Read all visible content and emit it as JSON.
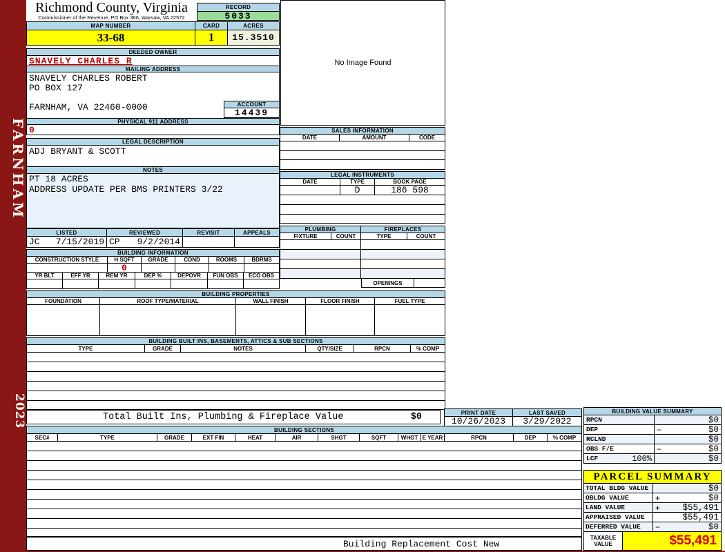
{
  "colors": {
    "maroon": "#8b1616",
    "header_blue": "#b3d7e7",
    "yellow": "#ffff00",
    "green": "#99dd99",
    "cream": "#f2f0df",
    "pale_row": "#eef3fa",
    "red_text": "#c00000"
  },
  "sidebar": {
    "district": "FARNHAM",
    "year": "2023"
  },
  "header": {
    "county": "Richmond County, Virginia",
    "commissioner": "Commissioner of the Revenue, PO Box 366, Warsaw, VA 22572",
    "record_label": "RECORD",
    "record": "5033",
    "map_number_label": "MAP NUMBER",
    "map_number": "33-68",
    "card_label": "CARD",
    "card": "1",
    "acres_label": "ACRES",
    "acres": "15.3510"
  },
  "owner": {
    "deeded_owner_label": "DEEDED OWNER",
    "deeded_owner": "SNAVELY CHARLES R",
    "mailing_address_label": "MAILING ADDRESS",
    "mailing_line1": "SNAVELY CHARLES ROBERT",
    "mailing_line2": "PO BOX 127",
    "mailing_city": "FARNHAM, VA 22460-0000",
    "account_label": "ACCOUNT",
    "account": "14439",
    "physical_address_label": "PHYSICAL 911 ADDRESS",
    "physical_address": "0",
    "legal_description_label": "LEGAL DESCRIPTION",
    "legal_description": "ADJ BRYANT & SCOTT",
    "notes_label": "NOTES",
    "notes_line1": "PT 18 ACRES",
    "notes_line2": "ADDRESS UPDATE PER BMS PRINTERS 3/22"
  },
  "review": {
    "listed_label": "LISTED",
    "reviewed_label": "REVIEWED",
    "revisit_label": "REVISIT",
    "appeals_label": "APPEALS",
    "listed_initials": "JC",
    "listed_date": "7/15/2019",
    "reviewed_initials": "CP",
    "reviewed_date": "9/2/2014"
  },
  "building_information": {
    "title": "BUILDING INFORMATION",
    "headers_row1": [
      "CONSTRUCTION STYLE",
      "H SQFT",
      "GRADE",
      "COND",
      "ROOMS",
      "BDRMS"
    ],
    "h_sqft_value": "0",
    "headers_row2": [
      "YR BLT",
      "EFF YR",
      "REM YR",
      "DEP %",
      "DEPOVR",
      "FUN OBS",
      "ECO OBS"
    ]
  },
  "image_panel": {
    "no_image_text": "No Image Found"
  },
  "sales_information": {
    "title": "SALES INFORMATION",
    "headers": [
      "DATE",
      "AMOUNT",
      "CODE"
    ]
  },
  "legal_instruments": {
    "title": "LEGAL INSTRUMENTS",
    "headers": [
      "DATE",
      "TYPE",
      "BOOK PAGE"
    ],
    "row1": {
      "date": "",
      "type": "D",
      "book_page": "186 598"
    }
  },
  "plumbing": {
    "title": "PLUMBING",
    "fixture_label": "FIXTURE",
    "count_label": "COUNT"
  },
  "fireplaces": {
    "title": "FIREPLACES",
    "type_label": "TYPE",
    "count_label": "COUNT",
    "openings_label": "OPENINGS"
  },
  "building_properties": {
    "title": "BUILDING PROPERTIES",
    "headers": [
      "FOUNDATION",
      "ROOF TYPE/MATERIAL",
      "WALL FINISH",
      "FLOOR FINISH",
      "FUEL TYPE"
    ]
  },
  "built_ins": {
    "title": "BUILDING BUILT INS, BASEMENTS, ATTICS & SUB SECTIONS",
    "headers": [
      "TYPE",
      "GRADE",
      "NOTES",
      "QTY/SIZE",
      "RPCN",
      "% COMP"
    ],
    "total_label": "Total Built Ins, Plumbing & Fireplace Value",
    "total_value": "$0"
  },
  "print_info": {
    "print_date_label": "PRINT DATE",
    "print_date": "10/26/2023",
    "last_saved_label": "LAST SAVED",
    "last_saved": "3/29/2022"
  },
  "building_sections": {
    "title": "BUILDING SECTIONS",
    "headers": [
      "SEC#",
      "TYPE",
      "GRADE",
      "EXT FIN",
      "HEAT",
      "AIR",
      "SHGT",
      "SQFT",
      "WHGT",
      "E YEAR",
      "RPCN",
      "DEP",
      "% COMP"
    ],
    "footer_note": "Building Replacement Cost New"
  },
  "building_value_summary": {
    "title": "BUILDING VALUE SUMMARY",
    "rows": [
      {
        "label": "RPCN",
        "suffix": "",
        "op": "",
        "value": "$0"
      },
      {
        "label": "DEP",
        "suffix": "",
        "op": "−",
        "value": "$0"
      },
      {
        "label": "RCLND",
        "suffix": "",
        "op": "",
        "value": "$0"
      },
      {
        "label": "OBS F/E",
        "suffix": "",
        "op": "−",
        "value": "$0"
      },
      {
        "label": "LCF",
        "suffix": "100%",
        "op": "",
        "value": "$0"
      }
    ]
  },
  "parcel_summary": {
    "title": "PARCEL SUMMARY",
    "rows": [
      {
        "label": "TOTAL BLDG VALUE",
        "op": "",
        "value": "$0"
      },
      {
        "label": "OBLDG VALUE",
        "op": "+",
        "value": "$0"
      },
      {
        "label": "LAND VALUE",
        "op": "+",
        "value": "$55,491"
      },
      {
        "label": "APPRAISED VALUE",
        "op": "",
        "value": "$55,491"
      },
      {
        "label": "DEFERRED VALUE",
        "op": "−",
        "value": "$0"
      }
    ],
    "taxable_label": "TAXABLE VALUE",
    "taxable_value": "$55,491"
  }
}
